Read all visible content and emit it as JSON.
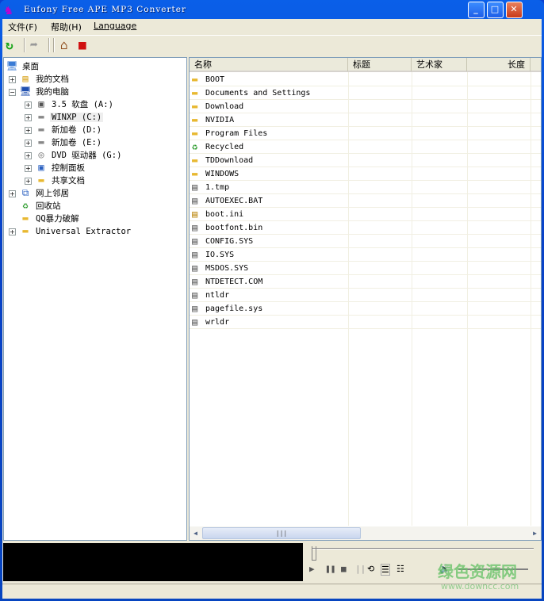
{
  "window": {
    "title": "Eufony Free APE MP3 Converter",
    "minimize": "_",
    "maximize": "□",
    "close": "✕"
  },
  "menu": {
    "file": "文件(F)",
    "help": "帮助(H)",
    "language": "Language"
  },
  "toolbar": {
    "icons": [
      "refresh-icon",
      "forward-icon",
      "home-icon",
      "book-icon"
    ]
  },
  "tree": [
    {
      "label": "桌面",
      "icon": "desktop-icon",
      "level": 0,
      "expander": ""
    },
    {
      "label": "我的文档",
      "icon": "documents-icon",
      "level": 1,
      "expander": "+"
    },
    {
      "label": "我的电脑",
      "icon": "computer-icon",
      "level": 1,
      "expander": "−"
    },
    {
      "label": "3.5 软盘 (A:)",
      "icon": "floppy-icon",
      "level": 2,
      "expander": "+"
    },
    {
      "label": "WINXP (C:)",
      "icon": "drive-icon",
      "level": 2,
      "expander": "+",
      "selected": true
    },
    {
      "label": "新加卷 (D:)",
      "icon": "drive-icon",
      "level": 2,
      "expander": "+"
    },
    {
      "label": "新加卷 (E:)",
      "icon": "drive-icon",
      "level": 2,
      "expander": "+"
    },
    {
      "label": "DVD 驱动器 (G:)",
      "icon": "dvd-icon",
      "level": 2,
      "expander": "+"
    },
    {
      "label": "控制面板",
      "icon": "control-panel-icon",
      "level": 2,
      "expander": "+"
    },
    {
      "label": "共享文档",
      "icon": "folder-icon",
      "level": 2,
      "expander": "+"
    },
    {
      "label": "网上邻居",
      "icon": "network-icon",
      "level": 1,
      "expander": "+"
    },
    {
      "label": "回收站",
      "icon": "recycle-bin-icon",
      "level": 1,
      "expander": ""
    },
    {
      "label": "QQ暴力破解",
      "icon": "folder-icon",
      "level": 1,
      "expander": ""
    },
    {
      "label": "Universal Extractor",
      "icon": "folder-icon",
      "level": 1,
      "expander": "+"
    }
  ],
  "columns": [
    "名称",
    "标题",
    "艺术家",
    "长度",
    ""
  ],
  "files": [
    {
      "name": "BOOT",
      "icon": "folder-icon"
    },
    {
      "name": "Documents and Settings",
      "icon": "folder-icon"
    },
    {
      "name": "Download",
      "icon": "folder-icon"
    },
    {
      "name": "NVIDIA",
      "icon": "folder-icon"
    },
    {
      "name": "Program Files",
      "icon": "folder-icon"
    },
    {
      "name": "Recycled",
      "icon": "recycle-bin-icon"
    },
    {
      "name": "TDDownload",
      "icon": "folder-icon"
    },
    {
      "name": "WINDOWS",
      "icon": "folder-icon"
    },
    {
      "name": "1.tmp",
      "icon": "file-icon"
    },
    {
      "name": "AUTOEXEC.BAT",
      "icon": "file-icon"
    },
    {
      "name": "boot.ini",
      "icon": "ini-file-icon"
    },
    {
      "name": "bootfont.bin",
      "icon": "file-icon"
    },
    {
      "name": "CONFIG.SYS",
      "icon": "file-icon"
    },
    {
      "name": "IO.SYS",
      "icon": "file-icon"
    },
    {
      "name": "MSDOS.SYS",
      "icon": "file-icon"
    },
    {
      "name": "NTDETECT.COM",
      "icon": "file-icon"
    },
    {
      "name": "ntldr",
      "icon": "file-icon"
    },
    {
      "name": "pagefile.sys",
      "icon": "file-icon"
    },
    {
      "name": "wrldr",
      "icon": "file-icon"
    }
  ],
  "player": {
    "progress": 0,
    "volume": 0.7
  },
  "watermark": {
    "cn": "绿色资源网",
    "url": "www.downcc.com"
  },
  "colors": {
    "titlebar": "#0a5fe8",
    "face": "#ece9d8",
    "folder": "#f2c94c"
  }
}
